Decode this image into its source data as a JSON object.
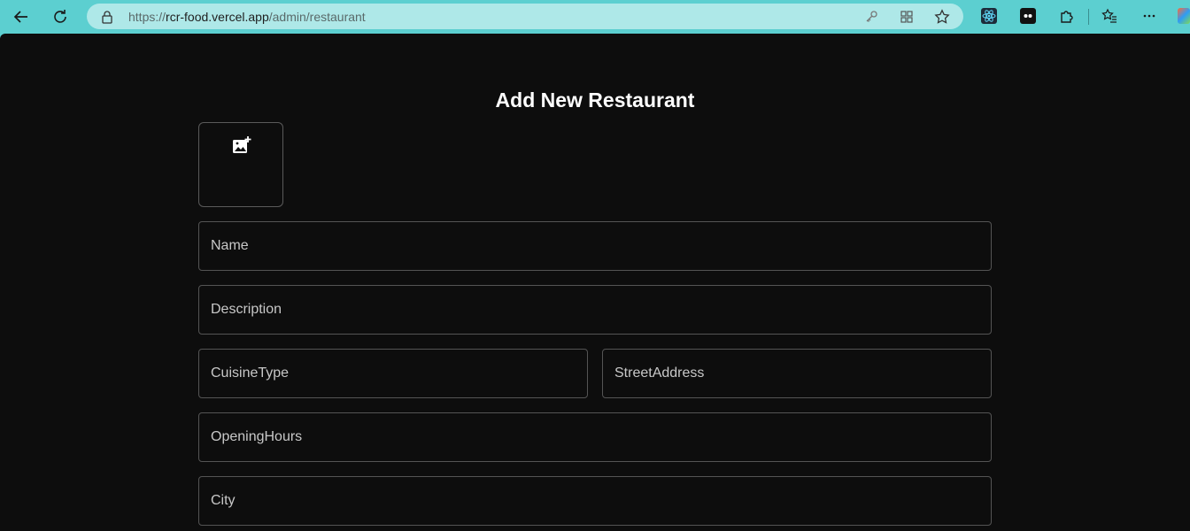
{
  "browser": {
    "url_prefix": "https://",
    "url_host": "rcr-food.vercel.app",
    "url_path": "/admin/restaurant",
    "icons": [
      "back-icon",
      "refresh-icon",
      "lock-icon",
      "key-icon",
      "apps-icon",
      "star-icon",
      "react-devtools-icon",
      "extension-icon",
      "puzzle-icon",
      "favorites-icon",
      "more-icon"
    ]
  },
  "page": {
    "title": "Add New Restaurant",
    "fields": {
      "name": "Name",
      "description": "Description",
      "cuisine_type": "CuisineType",
      "street_address": "StreetAddress",
      "opening_hours": "OpeningHours",
      "city": "City"
    }
  },
  "colors": {
    "toolbar": "#5ccfd0",
    "page_background": "#0d0d0d",
    "field_border": "#545454",
    "title": "#ffffff"
  }
}
